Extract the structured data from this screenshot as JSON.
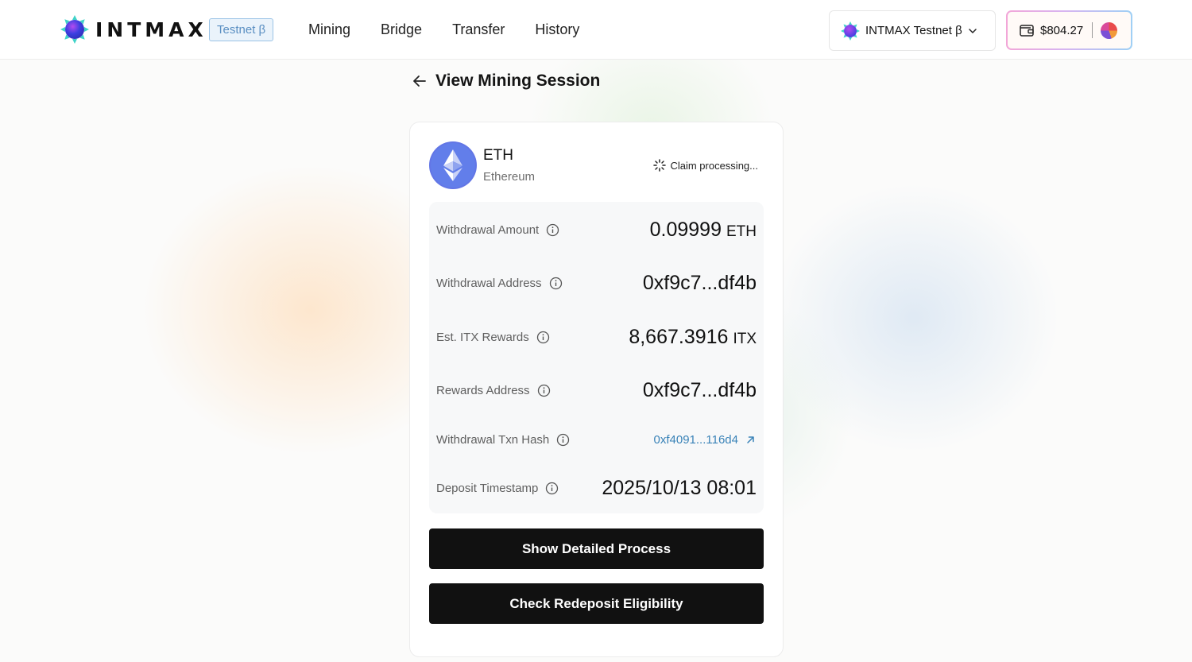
{
  "header": {
    "logo_text": "INTMAX",
    "testnet_badge": "Testnet β",
    "nav": [
      "Mining",
      "Bridge",
      "Transfer",
      "History"
    ],
    "network": "INTMAX Testnet β",
    "wallet_balance": "$804.27"
  },
  "page": {
    "title": "View Mining Session"
  },
  "session": {
    "token_symbol": "ETH",
    "token_name": "Ethereum",
    "status": "Claim processing...",
    "rows": {
      "withdrawal_amount": {
        "label": "Withdrawal Amount",
        "value": "0.09999",
        "unit": "ETH"
      },
      "withdrawal_address": {
        "label": "Withdrawal Address",
        "value": "0xf9c7...df4b"
      },
      "est_rewards": {
        "label": "Est. ITX Rewards",
        "value": "8,667.3916",
        "unit": "ITX"
      },
      "rewards_address": {
        "label": "Rewards Address",
        "value": "0xf9c7...df4b"
      },
      "withdrawal_txn_hash": {
        "label": "Withdrawal Txn Hash",
        "value": "0xf4091...116d4"
      },
      "deposit_timestamp": {
        "label": "Deposit Timestamp",
        "value": "2025/10/13 08:01"
      }
    }
  },
  "actions": {
    "show_process": "Show Detailed Process",
    "check_redeposit": "Check Redeposit Eligibility"
  },
  "icons": {
    "logo": "intmax-logo-icon",
    "network": "intmax-network-icon",
    "wallet": "wallet-icon",
    "back": "arrow-left-icon",
    "token": "ethereum-icon",
    "status": "spinner-icon",
    "info": "info-icon",
    "external_link": "external-link-icon"
  },
  "colors": {
    "primary_button": "#111111",
    "link": "#3a83b8",
    "badge_border": "#9cc4e6",
    "badge_text": "#5a8fc2"
  }
}
